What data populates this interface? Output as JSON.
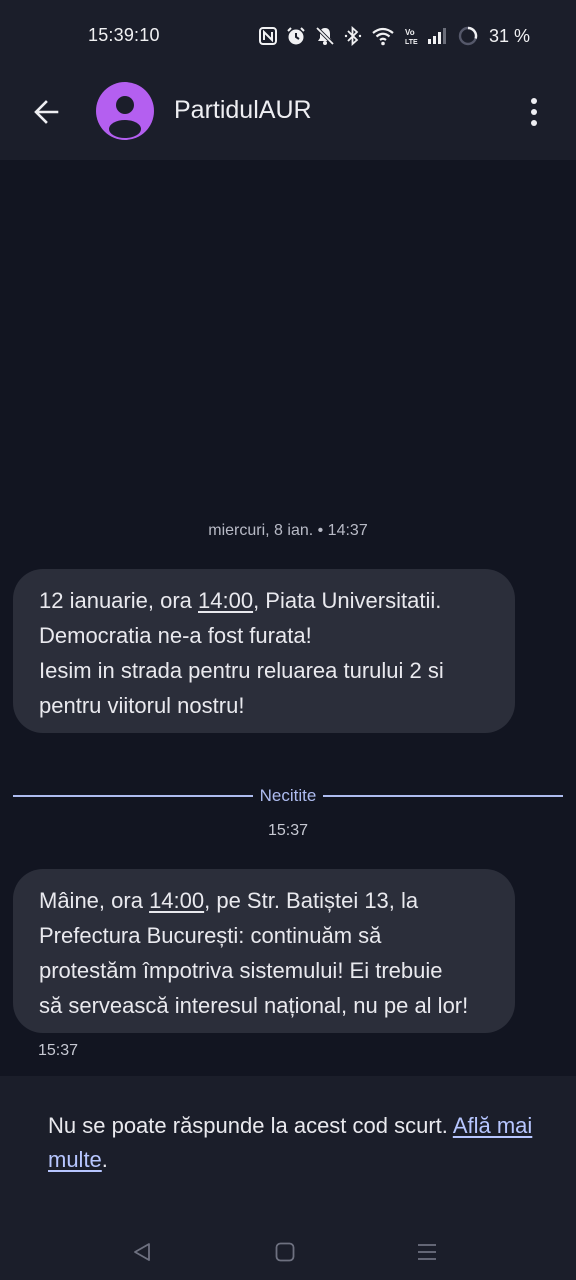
{
  "status_bar": {
    "time": "15:39:10",
    "battery": "31 %",
    "icons": [
      "nfc-icon",
      "alarm-icon",
      "mute-icon",
      "bluetooth-icon",
      "wifi-icon",
      "volte-icon",
      "signal-icon",
      "battery-icon"
    ]
  },
  "header": {
    "contact_name": "PartidulAUR",
    "avatar_color": "#b45ff0",
    "back_icon": "arrow-left-icon",
    "more_icon": "more-vert-icon"
  },
  "conversation": {
    "date_header": "miercuri, 8 ian. • 14:37",
    "message_1": {
      "line_1_pre": "12 ianuarie, ora ",
      "line_1_time": "14:00",
      "line_1_post": ", Piata Universitatii.",
      "line_2": "Democratia ne-a fost furata!",
      "line_3": "Iesim in strada pentru reluarea turului 2 si",
      "line_4": "pentru viitorul nostru!"
    },
    "unread_label": "Necitite",
    "unread_time": "15:37",
    "message_2": {
      "line_1_pre": "Mâine, ora ",
      "line_1_time": "14:00",
      "line_1_post": ", pe Str. Batiștei 13, la",
      "line_2": "Prefectura București: continuăm să",
      "line_3": "protestăm împotriva sistemului! Ei trebuie",
      "line_4": "să servească interesul național, nu pe al lor!"
    },
    "message_2_time": "15:37"
  },
  "reply_notice": {
    "text": "Nu se poate răspunde la acest cod scurt. ",
    "link": "Află mai multe",
    "suffix": "."
  },
  "nav_bar": {
    "icons": [
      "nav-back-icon",
      "nav-home-icon",
      "nav-recents-icon"
    ]
  },
  "colors": {
    "background": "#121521",
    "bar": "#1b1e2a",
    "bubble": "#2b2e3a",
    "accent": "#aebcf0"
  }
}
